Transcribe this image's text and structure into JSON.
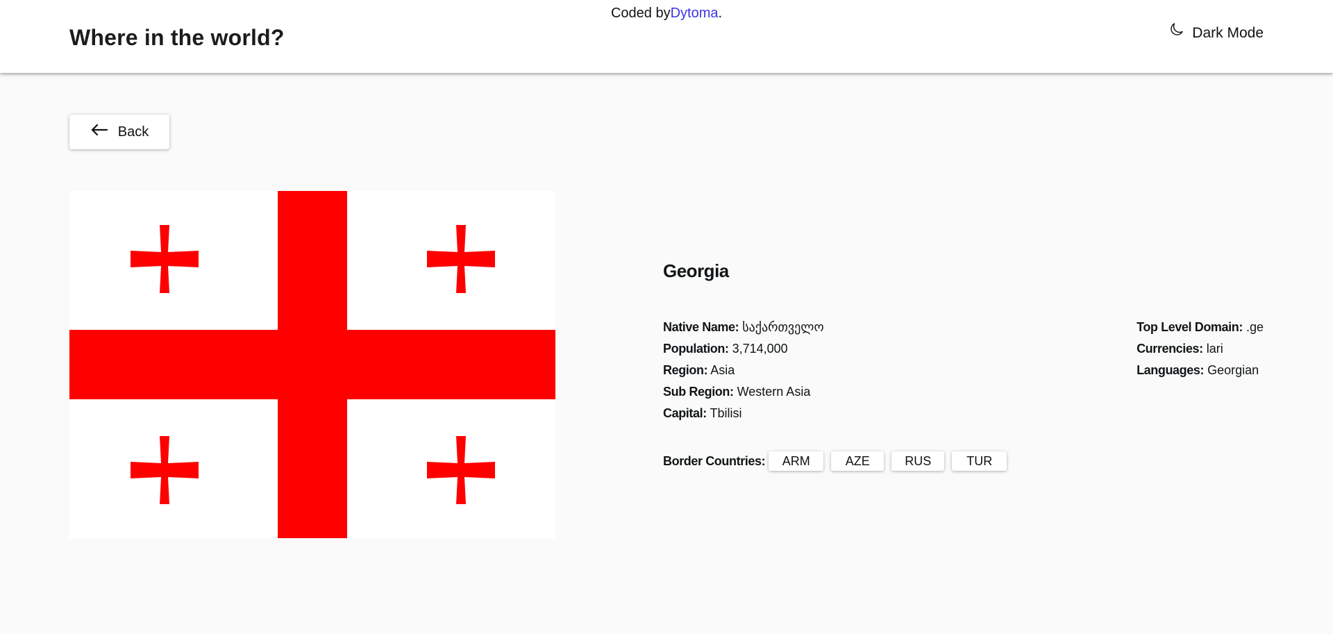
{
  "attribution": {
    "prefix": "Coded by",
    "author": "Dytoma",
    "suffix": "."
  },
  "header": {
    "title": "Where in the world?",
    "mode_label": "Dark Mode",
    "mode_icon": "moon-icon"
  },
  "back": {
    "label": "Back",
    "icon": "arrow-left-icon"
  },
  "flag": {
    "country": "Georgia",
    "colors": {
      "field": "#ffffff",
      "cross": "#ff0000"
    }
  },
  "country": {
    "name": "Georgia",
    "left": [
      {
        "label": "Native Name:",
        "value": "საქართველო"
      },
      {
        "label": "Population:",
        "value": "3,714,000"
      },
      {
        "label": "Region:",
        "value": "Asia"
      },
      {
        "label": "Sub Region:",
        "value": "Western Asia"
      },
      {
        "label": "Capital:",
        "value": "Tbilisi"
      }
    ],
    "right": [
      {
        "label": "Top Level Domain:",
        "value": ".ge"
      },
      {
        "label": "Currencies:",
        "value": "lari"
      },
      {
        "label": "Languages:",
        "value": "Georgian"
      }
    ],
    "borders_label": "Border Countries:",
    "borders": [
      "ARM",
      "AZE",
      "RUS",
      "TUR"
    ]
  },
  "colors": {
    "background": "#fafafa",
    "header": "#ffffff",
    "link": "#3b33e8"
  }
}
